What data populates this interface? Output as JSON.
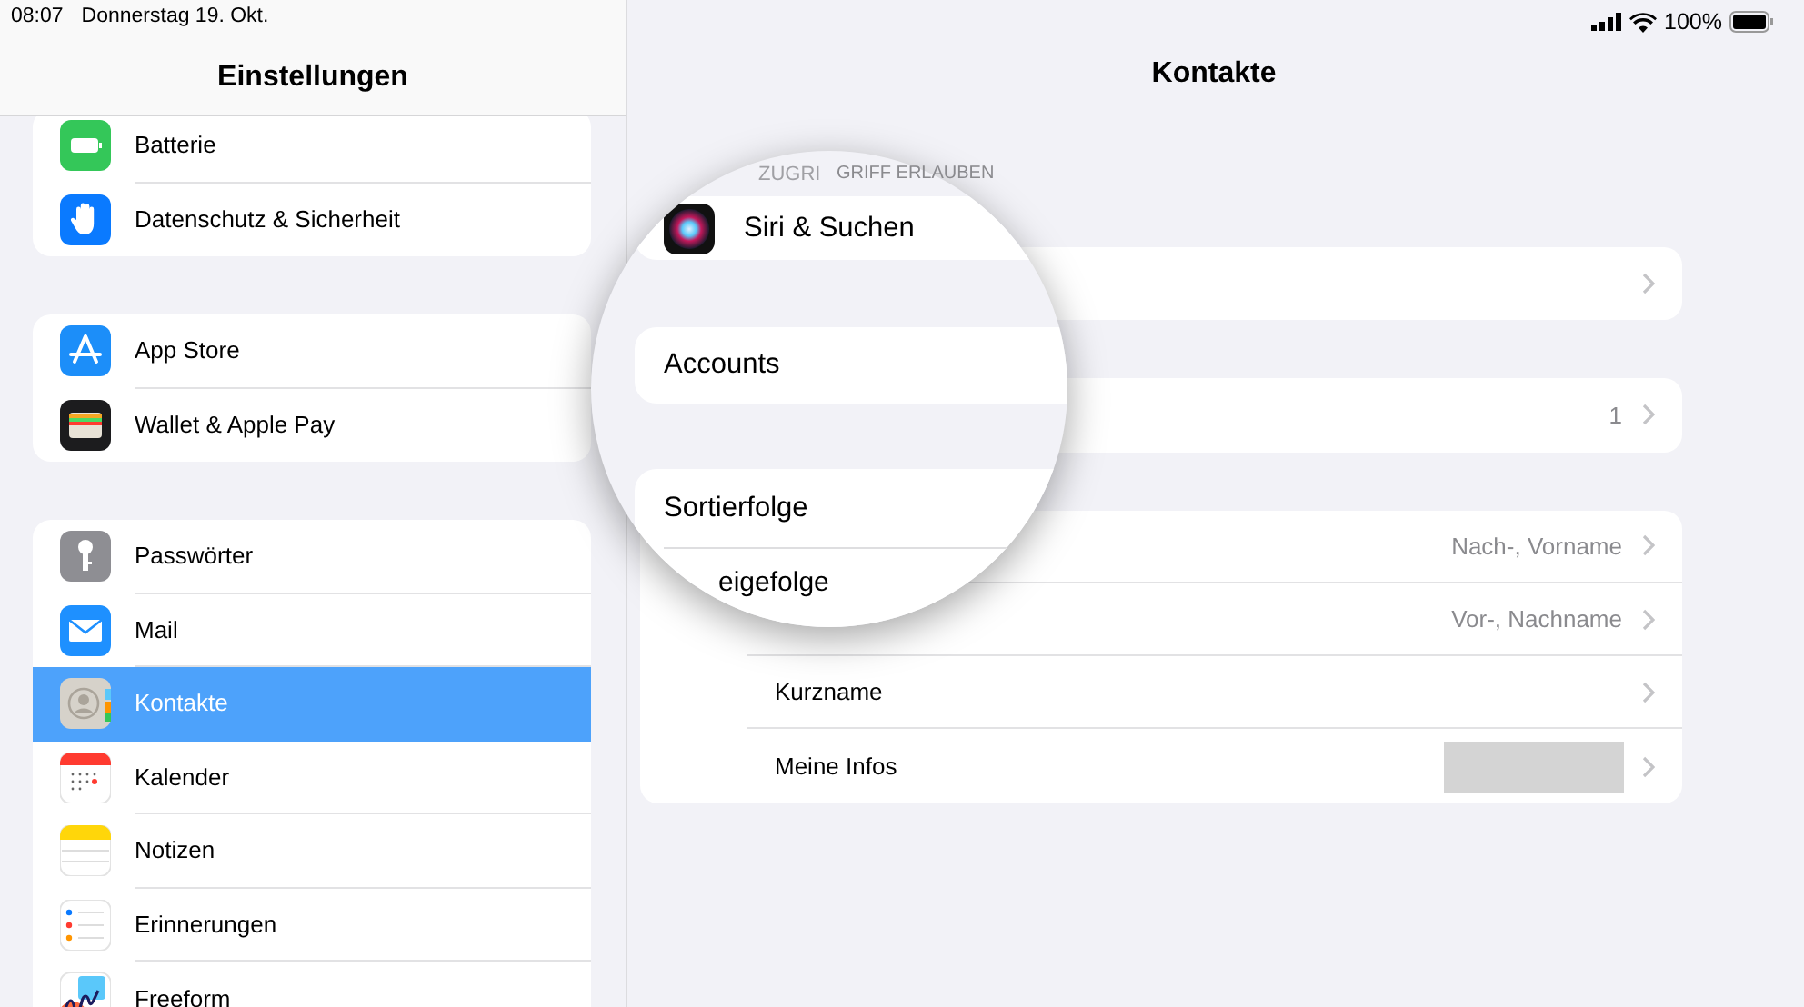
{
  "status_bar": {
    "time": "08:07",
    "date": "Donnerstag 19. Okt.",
    "battery_text": "100%"
  },
  "sidebar": {
    "title": "Einstellungen",
    "groups": [
      {
        "items": [
          {
            "label": "Batterie",
            "selected": false
          },
          {
            "label": "Datenschutz & Sicherheit",
            "selected": false
          }
        ]
      },
      {
        "items": [
          {
            "label": "App Store",
            "selected": false
          },
          {
            "label": "Wallet & Apple Pay",
            "selected": false
          }
        ]
      },
      {
        "items": [
          {
            "label": "Passwörter",
            "selected": false
          },
          {
            "label": "Mail",
            "selected": false
          },
          {
            "label": "Kontakte",
            "selected": true
          },
          {
            "label": "Kalender",
            "selected": false
          },
          {
            "label": "Notizen",
            "selected": false
          },
          {
            "label": "Erinnerungen",
            "selected": false
          },
          {
            "label": "Freeform",
            "selected": false
          }
        ]
      }
    ]
  },
  "detail": {
    "title": "Kontakte",
    "section_header": "GRIFF ERLAUBEN",
    "groups": [
      {
        "rows": [
          {
            "value": ""
          }
        ]
      },
      {
        "rows": [
          {
            "value": "1"
          }
        ]
      },
      {
        "rows": [
          {
            "value": "Nach-, Vorname"
          },
          {
            "value": "Vor-, Nachname"
          },
          {
            "label": "Kurzname"
          },
          {
            "label": "Meine Infos",
            "redacted": true
          }
        ]
      }
    ]
  },
  "magnifier": {
    "header": "ZUGRI",
    "rows": [
      {
        "kind": "icon",
        "label": "Siri & Suchen"
      },
      {
        "kind": "plain",
        "label": "Accounts"
      },
      {
        "kind": "first",
        "label": "Sortierfolge"
      },
      {
        "kind": "cut",
        "label": "eigefolge"
      }
    ]
  }
}
